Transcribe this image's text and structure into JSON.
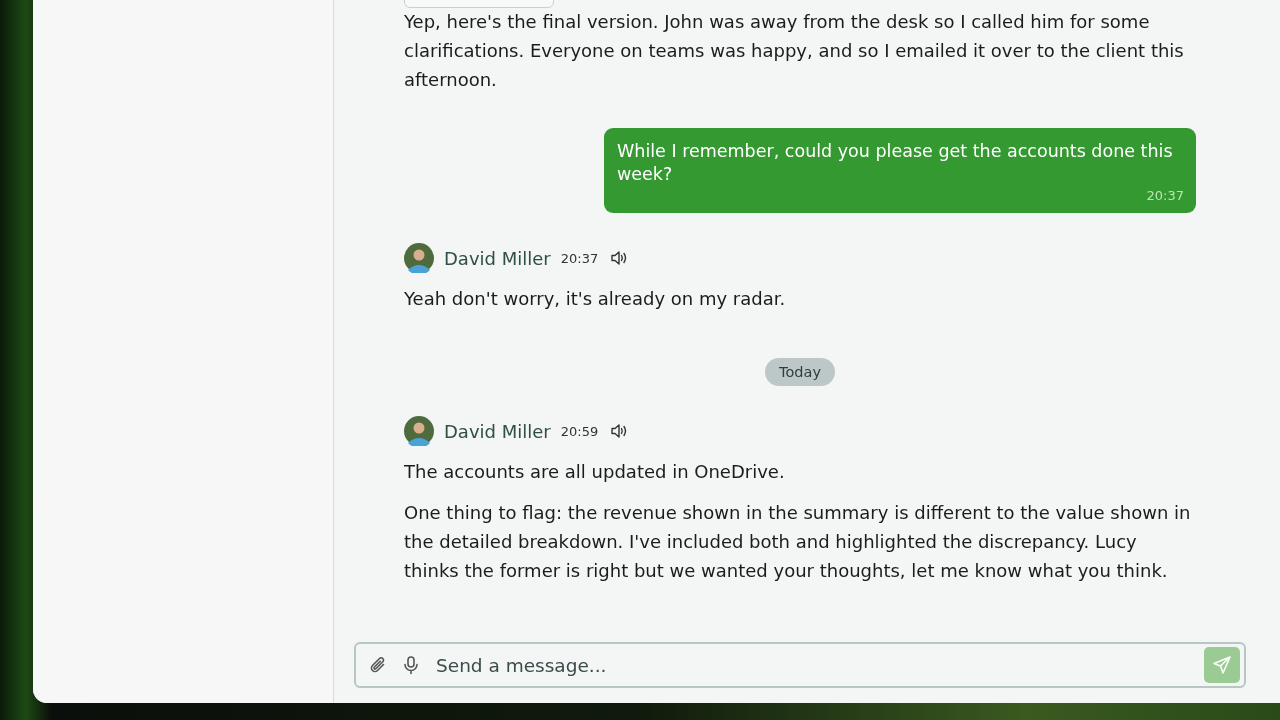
{
  "messages": [
    {
      "kind": "incoming",
      "attachment": true,
      "paragraphs": [
        "Yep, here's the final version. John was away from the desk so I called him for some clarifications. Everyone on teams was happy, and so I emailed it over to the client this afternoon."
      ]
    },
    {
      "kind": "outgoing",
      "text": "While I remember, could you please get the accounts done this week?",
      "time": "20:37"
    },
    {
      "kind": "incoming",
      "sender": "David Miller",
      "time": "20:37",
      "paragraphs": [
        "Yeah don't worry, it's already on my radar."
      ]
    },
    {
      "kind": "divider",
      "text": "Today"
    },
    {
      "kind": "incoming",
      "sender": "David Miller",
      "time": "20:59",
      "paragraphs": [
        "The accounts are all updated in OneDrive.",
        "One thing to flag: the revenue shown in the summary is different to the value shown in the detailed breakdown. I've included both and highlighted the discrepancy. Lucy thinks the former is right but we wanted your thoughts, let me know what you think."
      ]
    }
  ],
  "composer": {
    "placeholder": "Send a message..."
  }
}
